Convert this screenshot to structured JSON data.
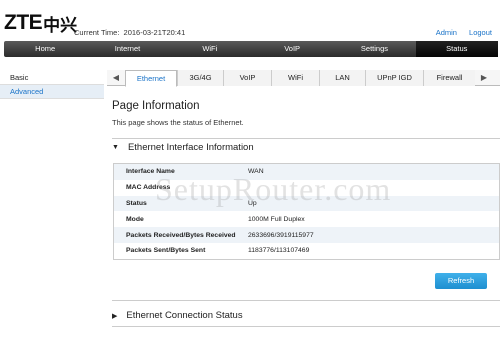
{
  "header": {
    "logo_text": "ZTE",
    "logo_cn": "中兴",
    "time_label": "Current Time:",
    "time_value": "2016-03-21T20:41",
    "admin_link": "Admin",
    "logout_link": "Logout"
  },
  "main_nav": [
    {
      "label": "Home",
      "active": false
    },
    {
      "label": "Internet",
      "active": false
    },
    {
      "label": "WiFi",
      "active": false
    },
    {
      "label": "VoIP",
      "active": false
    },
    {
      "label": "Settings",
      "active": false
    },
    {
      "label": "Status",
      "active": true
    }
  ],
  "sidebar": {
    "items": [
      {
        "label": "Basic",
        "active": false
      },
      {
        "label": "Advanced",
        "active": true
      }
    ]
  },
  "subtabs": [
    {
      "label": "Ethernet",
      "active": true
    },
    {
      "label": "3G/4G",
      "active": false
    },
    {
      "label": "VoIP",
      "active": false
    },
    {
      "label": "WiFi",
      "active": false
    },
    {
      "label": "LAN",
      "active": false
    },
    {
      "label": "UPnP IGD",
      "active": false
    },
    {
      "label": "Firewall",
      "active": false
    }
  ],
  "page": {
    "title": "Page Information",
    "description": "This page shows the status of Ethernet."
  },
  "sections": {
    "interface_title": "Ethernet Interface Information",
    "connection_title": "Ethernet Connection Status"
  },
  "interface_table": [
    {
      "key": "Interface Name",
      "value": "WAN"
    },
    {
      "key": "MAC Address",
      "value": ""
    },
    {
      "key": "Status",
      "value": "Up"
    },
    {
      "key": "Mode",
      "value": "1000M Full Duplex"
    },
    {
      "key": "Packets Received/Bytes Received",
      "value": "2633696/3919115977"
    },
    {
      "key": "Packets Sent/Bytes Sent",
      "value": "1183776/113107469"
    }
  ],
  "refresh_label": "Refresh",
  "watermark": "SetupRouter.com",
  "colors": {
    "accent": "#1a73c8",
    "button": "#2a9ddf",
    "nav_bg": "#3a3a3a"
  }
}
